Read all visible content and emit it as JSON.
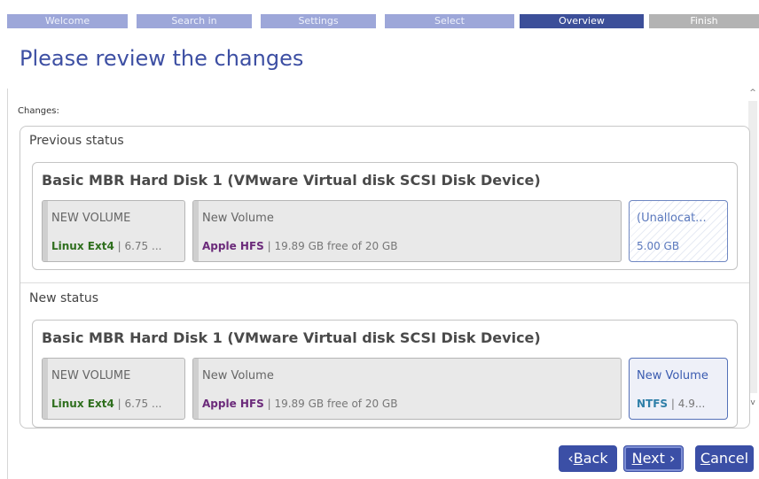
{
  "wizard": {
    "steps": [
      "Welcome",
      "Search in",
      "Settings",
      "Select",
      "Overview",
      "Finish"
    ],
    "active_step": "Overview"
  },
  "page": {
    "title": "Please review the changes",
    "changes_label": "Changes:"
  },
  "previous": {
    "label": "Previous status",
    "disk_title": "Basic MBR Hard Disk 1 (VMware Virtual disk SCSI Disk Device)",
    "partitions": [
      {
        "name": "NEW VOLUME",
        "fs": "Linux Ext4",
        "info": " | 6.75 ..."
      },
      {
        "name": "New Volume",
        "fs": "Apple HFS",
        "info": " | 19.89 GB free of 20 GB"
      },
      {
        "name": "(Unallocat...",
        "fs": "",
        "info": "5.00 GB"
      }
    ]
  },
  "new": {
    "label": "New status",
    "disk_title": "Basic MBR Hard Disk 1 (VMware Virtual disk SCSI Disk Device)",
    "partitions": [
      {
        "name": "NEW VOLUME",
        "fs": "Linux Ext4",
        "info": " | 6.75 ..."
      },
      {
        "name": "New Volume",
        "fs": "Apple HFS",
        "info": " | 19.89 GB free of 20 GB"
      },
      {
        "name": "New Volume",
        "fs": "NTFS",
        "info": " | 4.9..."
      }
    ]
  },
  "buttons": {
    "back_arrow": "‹",
    "back_accesskey": "B",
    "back_rest": "ack",
    "next_accesskey": "N",
    "next_rest": "ext",
    "next_arrow": "›",
    "cancel_accesskey": "C",
    "cancel_rest": "ancel"
  },
  "scrollbar": {
    "up_glyph": "^",
    "down_glyph": "v"
  },
  "colors": {
    "accent": "#3b4fa6",
    "step_inactive": "#9da7d9",
    "step_active": "#3c4f99",
    "step_finish": "#b3b3b3"
  }
}
